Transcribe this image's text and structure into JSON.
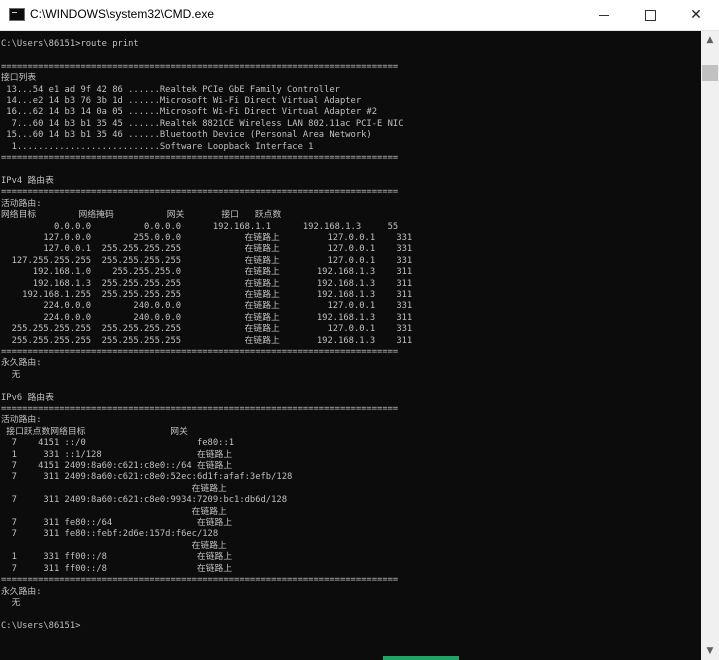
{
  "window": {
    "title": "C:\\WINDOWS\\system32\\CMD.exe",
    "controls": {
      "minimize": "—",
      "maximize": "□",
      "close": "✕"
    }
  },
  "console": {
    "prompt": "C:\\Users\\86151>",
    "command": "route print",
    "separator": "===========================================================================",
    "interface_list": {
      "heading": "接口列表",
      "entries": [
        " 13...54 e1 ad 9f 42 86 ......Realtek PCIe GbE Family Controller",
        " 14...e2 14 b3 76 3b 1d ......Microsoft Wi-Fi Direct Virtual Adapter",
        " 16...62 14 b3 14 0a 05 ......Microsoft Wi-Fi Direct Virtual Adapter #2",
        "  7...60 14 b3 b1 35 45 ......Realtek 8821CE Wireless LAN 802.11ac PCI-E NIC",
        " 15...60 14 b3 b1 35 46 ......Bluetooth Device (Personal Area Network)",
        "  1...........................Software Loopback Interface 1"
      ]
    },
    "ipv4": {
      "heading": "IPv4 路由表",
      "active_routes_label": "活动路由:",
      "columns_line": "网络目标        网络掩码          网关       接口   跃点数",
      "rows": [
        "          0.0.0.0          0.0.0.0      192.168.1.1      192.168.1.3     55",
        "        127.0.0.0        255.0.0.0            在链路上         127.0.0.1    331",
        "        127.0.0.1  255.255.255.255            在链路上         127.0.0.1    331",
        "  127.255.255.255  255.255.255.255            在链路上         127.0.0.1    331",
        "      192.168.1.0    255.255.255.0            在链路上       192.168.1.3    311",
        "      192.168.1.3  255.255.255.255            在链路上       192.168.1.3    311",
        "    192.168.1.255  255.255.255.255            在链路上       192.168.1.3    311",
        "        224.0.0.0        240.0.0.0            在链路上         127.0.0.1    331",
        "        224.0.0.0        240.0.0.0            在链路上       192.168.1.3    311",
        "  255.255.255.255  255.255.255.255            在链路上         127.0.0.1    331",
        "  255.255.255.255  255.255.255.255            在链路上       192.168.1.3    311"
      ],
      "persistent_label": "永久路由:",
      "persistent_none": "  无"
    },
    "ipv6": {
      "heading": "IPv6 路由表",
      "active_routes_label": "活动路由:",
      "columns_line": " 接口跃点数网络目标                网关",
      "rows": [
        "  7    4151 ::/0                     fe80::1",
        "  1     331 ::1/128                  在链路上",
        "  7    4151 2409:8a60:c621:c8e0::/64 在链路上",
        "  7     311 2409:8a60:c621:c8e0:52ec:6d1f:afaf:3efb/128",
        "                                    在链路上",
        "  7     311 2409:8a60:c621:c8e0:9934:7209:bc1:db6d/128",
        "                                    在链路上",
        "  7     311 fe80::/64                在链路上",
        "  7     311 fe80::febf:2d6e:157d:f6ec/128",
        "                                    在链路上",
        "  1     331 ff00::/8                 在链路上",
        "  7     311 ff00::/8                 在链路上"
      ],
      "persistent_label": "永久路由:",
      "persistent_none": "  无"
    }
  }
}
